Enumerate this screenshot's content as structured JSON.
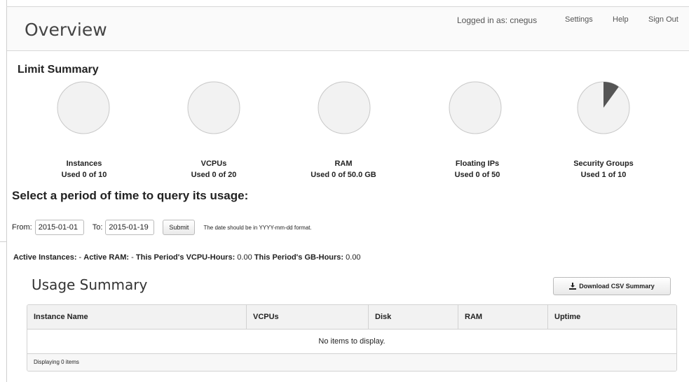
{
  "header": {
    "title": "Overview",
    "user_text": "Logged in as: cnegus",
    "nav": [
      "Settings",
      "Help",
      "Sign Out"
    ]
  },
  "limit_summary": {
    "title": "Limit Summary",
    "quotas": [
      {
        "name": "Instances",
        "used_text": "Used 0 of 10",
        "used": 0,
        "total": 10
      },
      {
        "name": "VCPUs",
        "used_text": "Used 0 of 20",
        "used": 0,
        "total": 20
      },
      {
        "name": "RAM",
        "used_text": "Used 0 of 50.0 GB",
        "used": 0,
        "total": 50.0
      },
      {
        "name": "Floating IPs",
        "used_text": "Used 0 of 50",
        "used": 0,
        "total": 50
      },
      {
        "name": "Security Groups",
        "used_text": "Used 1 of 10",
        "used": 1,
        "total": 10
      }
    ],
    "colors": {
      "pie_bg": "#f2f2f2",
      "pie_fill": "#555555",
      "pie_border": "#c8c8c8"
    }
  },
  "query": {
    "title": "Select a period of time to query its usage:",
    "from_label": "From:",
    "from_value": "2015-01-01",
    "to_label": "To:",
    "to_value": "2015-01-19",
    "submit_label": "Submit",
    "hint": "The date should be in YYYY-mm-dd format."
  },
  "stats": {
    "active_instances_label": "Active Instances:",
    "active_instances_value": "-",
    "active_ram_label": "Active RAM:",
    "active_ram_value": "-",
    "vcpu_hours_label": "This Period's VCPU-Hours:",
    "vcpu_hours_value": "0.00",
    "gb_hours_label": "This Period's GB-Hours:",
    "gb_hours_value": "0.00"
  },
  "usage": {
    "title": "Usage Summary",
    "download_label": "Download CSV Summary",
    "columns": [
      "Instance Name",
      "VCPUs",
      "Disk",
      "RAM",
      "Uptime"
    ],
    "empty_text": "No items to display.",
    "footer": "Displaying 0 items"
  }
}
